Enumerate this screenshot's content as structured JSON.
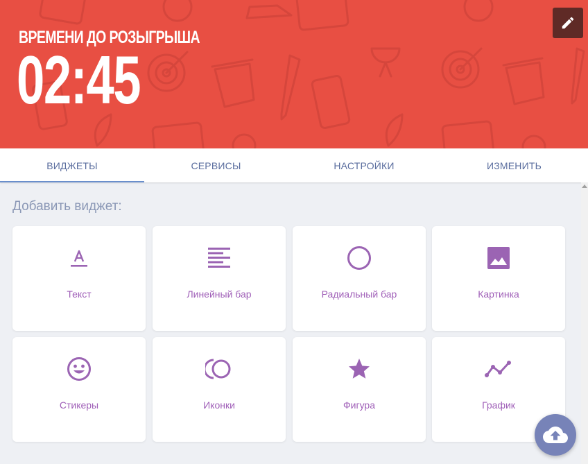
{
  "hero": {
    "caption": "ВРЕМЕНИ ДО РОЗЫГРЫША",
    "timer": "02:45",
    "edit_icon": "pencil-icon",
    "background_color": "#e84f43"
  },
  "tabs": [
    {
      "label": "ВИДЖЕТЫ",
      "active": true
    },
    {
      "label": "СЕРВИСЫ",
      "active": false
    },
    {
      "label": "НАСТРОЙКИ",
      "active": false
    },
    {
      "label": "ИЗМЕНИТЬ",
      "active": false
    }
  ],
  "main": {
    "section_title": "Добавить виджет:",
    "widgets": [
      {
        "label": "Текст",
        "icon": "text-format-icon"
      },
      {
        "label": "Линейный бар",
        "icon": "text-lines-icon"
      },
      {
        "label": "Радиальный бар",
        "icon": "circle-outline-icon"
      },
      {
        "label": "Картинка",
        "icon": "image-icon"
      },
      {
        "label": "Стикеры",
        "icon": "smiley-icon"
      },
      {
        "label": "Иконки",
        "icon": "icons-icon"
      },
      {
        "label": "Фигура",
        "icon": "star-icon"
      },
      {
        "label": "График",
        "icon": "chart-line-icon"
      }
    ]
  },
  "fab": {
    "icon": "cloud-upload-icon"
  },
  "colors": {
    "accent": "#9b64b3",
    "tab_text": "#5a6d9e",
    "fab": "#7783b8"
  }
}
